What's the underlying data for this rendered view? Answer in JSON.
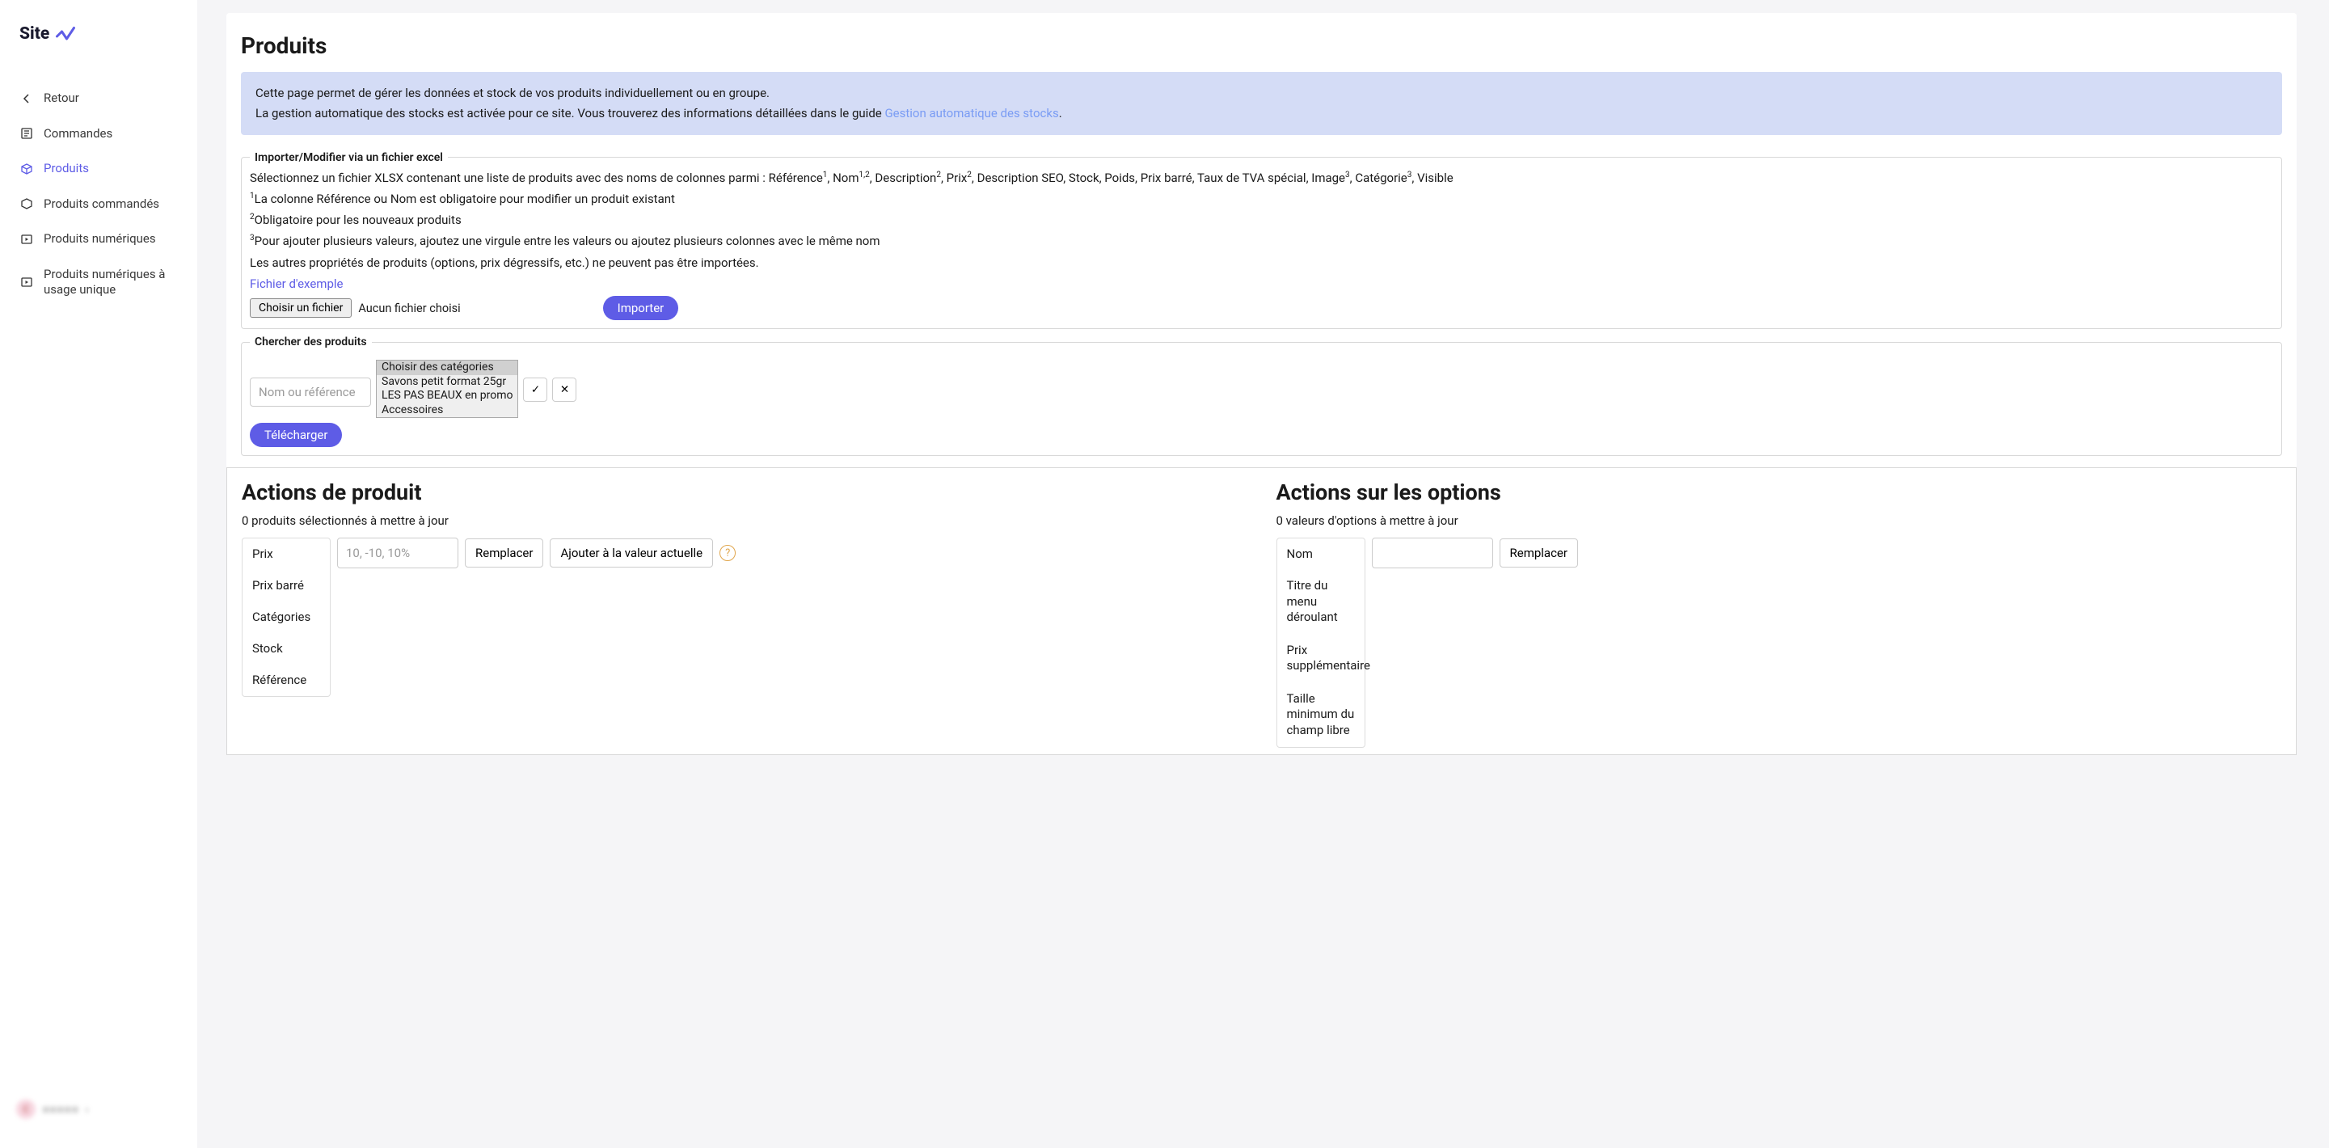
{
  "logo_text": "Sitew",
  "sidebar": {
    "back": "Retour",
    "items": [
      {
        "label": "Commandes"
      },
      {
        "label": "Produits"
      },
      {
        "label": "Produits commandés"
      },
      {
        "label": "Produits numériques"
      },
      {
        "label": "Produits numériques à usage unique"
      }
    ]
  },
  "footer": {
    "avatar_initial": "C",
    "name": "■■■■■",
    "chev": "›"
  },
  "page": {
    "title": "Produits",
    "info_line1": "Cette page permet de gérer les données et stock de vos produits individuellement ou en groupe.",
    "info_line2a": "La gestion automatique des stocks est activée pour ce site. Vous trouverez des informations détaillées dans le guide ",
    "info_link": "Gestion automatique des stocks",
    "info_dot": "."
  },
  "import": {
    "legend": "Importer/Modifier via un fichier excel",
    "desc_pre": "Sélectionnez un fichier XLSX contenant une liste de produits avec des noms de colonnes parmi : Référence",
    "sup1": "1",
    "c1": ", Nom",
    "sup12": "1,2",
    "c2": ", Description",
    "sup2a": "2",
    "c3": ", Prix",
    "sup2b": "2",
    "c4": ", Description SEO, Stock, Poids, Prix barré, Taux de TVA spécial, Image",
    "sup3a": "3",
    "c5": ", Catégorie",
    "sup3b": "3",
    "c6": ", Visible",
    "note1_sup": "1",
    "note1": "La colonne Référence ou Nom est obligatoire pour modifier un produit existant",
    "note2_sup": "2",
    "note2": "Obligatoire pour les nouveaux produits",
    "note3_sup": "3",
    "note3": "Pour ajouter plusieurs valeurs, ajoutez une virgule entre les valeurs ou ajoutez plusieurs colonnes avec le même nom",
    "other": "Les autres propriétés de produits (options, prix dégressifs, etc.) ne peuvent pas être importées.",
    "sample_link": "Fichier d'exemple",
    "choose": "Choisir un fichier",
    "nofile": "Aucun fichier choisi",
    "btn": "Importer"
  },
  "search": {
    "legend": "Chercher des produits",
    "placeholder": "Nom ou référence",
    "categories": [
      "Choisir des catégories",
      "Savons petit format 25gr",
      "LES PAS BEAUX en promo",
      "Accessoires"
    ],
    "download": "Télécharger"
  },
  "product_actions": {
    "title": "Actions de produit",
    "sub": "0 produits sélectionnés à mettre à jour",
    "tabs": [
      "Prix",
      "Prix barré",
      "Catégories",
      "Stock",
      "Référence"
    ],
    "input_ph": "10, -10, 10%",
    "replace": "Remplacer",
    "add": "Ajouter à la valeur actuelle",
    "help": "?"
  },
  "option_actions": {
    "title": "Actions sur les options",
    "sub": "0 valeurs d'options à mettre à jour",
    "tabs": [
      "Nom",
      "Titre du menu déroulant",
      "Prix supplémentaire",
      "Taille minimum du champ libre"
    ],
    "replace": "Remplacer"
  }
}
